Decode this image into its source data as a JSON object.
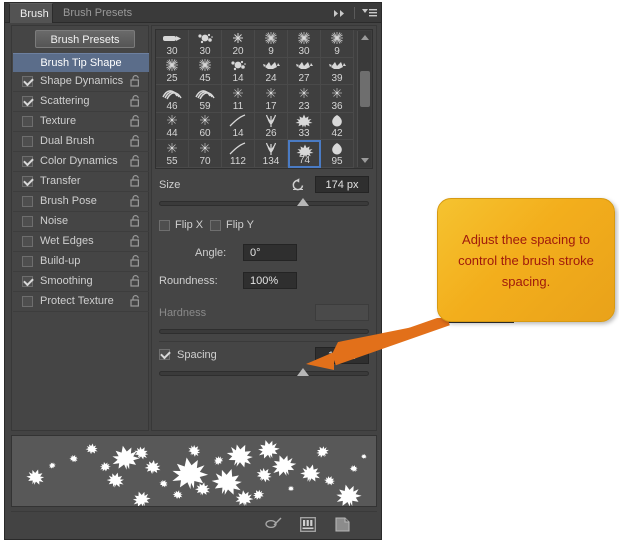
{
  "app": {
    "tabs": [
      {
        "label": "Brush",
        "active": true
      },
      {
        "label": "Brush Presets",
        "active": false
      }
    ],
    "panel_controls": [
      {
        "name": "collapse-icon",
        "glyph": "▶▶"
      },
      {
        "name": "panel-menu-icon",
        "glyph": "▾≡"
      }
    ]
  },
  "sidebar": {
    "presets_button": "Brush Presets",
    "section_header": "Brush Tip Shape",
    "items": [
      {
        "label": "Shape Dynamics",
        "checked": true,
        "locked": false
      },
      {
        "label": "Scattering",
        "checked": true,
        "locked": false
      },
      {
        "label": "Texture",
        "checked": false,
        "locked": false
      },
      {
        "label": "Dual Brush",
        "checked": false,
        "locked": false
      },
      {
        "label": "Color Dynamics",
        "checked": true,
        "locked": false
      },
      {
        "label": "Transfer",
        "checked": true,
        "locked": false
      },
      {
        "label": "Brush Pose",
        "checked": false,
        "locked": false
      },
      {
        "label": "Noise",
        "checked": false,
        "locked": false
      },
      {
        "label": "Wet Edges",
        "checked": false,
        "locked": false
      },
      {
        "label": "Build-up",
        "checked": false,
        "locked": false
      },
      {
        "label": "Smoothing",
        "checked": true,
        "locked": false
      },
      {
        "label": "Protect Texture",
        "checked": false,
        "locked": false
      }
    ]
  },
  "brush_grid": {
    "rows": [
      [
        {
          "size": "30",
          "shape": "chisel"
        },
        {
          "size": "30",
          "shape": "spatter"
        },
        {
          "size": "20",
          "shape": "spark"
        },
        {
          "size": "9",
          "shape": "burst"
        },
        {
          "size": "30",
          "shape": "burst"
        },
        {
          "size": "9",
          "shape": "burst"
        }
      ],
      [
        {
          "size": "25",
          "shape": "burst"
        },
        {
          "size": "45",
          "shape": "burst"
        },
        {
          "size": "14",
          "shape": "spatter"
        },
        {
          "size": "24",
          "shape": "leafy"
        },
        {
          "size": "27",
          "shape": "leafy"
        },
        {
          "size": "39",
          "shape": "leafy"
        }
      ],
      [
        {
          "size": "46",
          "shape": "stroke"
        },
        {
          "size": "59",
          "shape": "stroke"
        },
        {
          "size": "11",
          "shape": "star"
        },
        {
          "size": "17",
          "shape": "star"
        },
        {
          "size": "23",
          "shape": "star"
        },
        {
          "size": "36",
          "shape": "star"
        }
      ],
      [
        {
          "size": "44",
          "shape": "star"
        },
        {
          "size": "60",
          "shape": "star"
        },
        {
          "size": "14",
          "shape": "curve"
        },
        {
          "size": "26",
          "shape": "grass"
        },
        {
          "size": "33",
          "shape": "maple"
        },
        {
          "size": "42",
          "shape": "leaf"
        }
      ],
      [
        {
          "size": "55",
          "shape": "star"
        },
        {
          "size": "70",
          "shape": "star"
        },
        {
          "size": "112",
          "shape": "curve"
        },
        {
          "size": "134",
          "shape": "grass"
        },
        {
          "size": "74",
          "shape": "maple"
        },
        {
          "size": "95",
          "shape": "leaf"
        }
      ]
    ],
    "selected": {
      "row": 4,
      "col": 4,
      "size": "74"
    }
  },
  "controls": {
    "size": {
      "label": "Size",
      "value": "174 px",
      "slider_percent": 68,
      "reset_icon": "reset-icon"
    },
    "flip_x": {
      "label": "Flip X",
      "checked": false
    },
    "flip_y": {
      "label": "Flip Y",
      "checked": false
    },
    "angle": {
      "label": "Angle:",
      "value": "0°"
    },
    "roundness": {
      "label": "Roundness:",
      "value": "100%"
    },
    "hardness": {
      "label": "Hardness",
      "value": "",
      "disabled": true,
      "slider_percent": 0
    },
    "spacing": {
      "label": "Spacing",
      "checked": true,
      "value": "171%",
      "slider_percent": 68
    }
  },
  "bottom_bar": {
    "icons": [
      {
        "name": "toggle-brush-icon"
      },
      {
        "name": "brush-panel-icon"
      },
      {
        "name": "new-brush-icon"
      }
    ]
  },
  "callout": {
    "text": "Adjust thee spacing to control the brush stroke spacing.",
    "fill_color": "#f3b021",
    "text_color": "#a01a0c",
    "arrow_color": "#e2701a"
  }
}
